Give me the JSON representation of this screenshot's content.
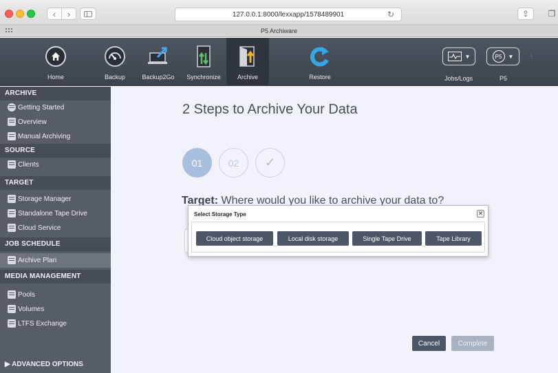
{
  "browser": {
    "url": "127.0.0.1:8000/lexxapp/1578489901",
    "tab_title": "P5   Archiware"
  },
  "toolbar": {
    "items": [
      {
        "label": "Home",
        "icon": "home-icon"
      },
      {
        "label": "Backup",
        "icon": "backup-gauge-icon"
      },
      {
        "label": "Backup2Go",
        "icon": "laptop-upload-icon"
      },
      {
        "label": "Synchronize",
        "icon": "synchronize-icon"
      },
      {
        "label": "Archive",
        "icon": "archive-door-icon",
        "active": true
      },
      {
        "label": "Restore",
        "icon": "restore-arrow-icon"
      }
    ],
    "jobs_label": "Jobs/Logs",
    "p5_label": "P5",
    "p5_badge": "P5"
  },
  "sidebar": {
    "archive_header": "ARCHIVE",
    "archive_items": [
      "Getting Started",
      "Overview",
      "Manual Archiving"
    ],
    "source_header": "SOURCE",
    "source_items": [
      "Clients"
    ],
    "target_header": "TARGET",
    "target_items": [
      "Storage Manager",
      "Standalone Tape Drive",
      "Cloud Service"
    ],
    "job_header": "JOB SCHEDULE",
    "job_items": [
      "Archive Plan"
    ],
    "media_header": "MEDIA MANAGEMENT",
    "media_items": [
      "Pools",
      "Volumes",
      "LTFS Exchange"
    ],
    "advanced": "▶ ADVANCED OPTIONS"
  },
  "main": {
    "title": "2 Steps to Archive Your Data",
    "steps": [
      "01",
      "02",
      "✓"
    ],
    "question_bold": "Target:",
    "question_text": " Where would you like to archive your data to?",
    "cancel": "Cancel",
    "complete": "Complete"
  },
  "modal": {
    "title": "Select Storage Type",
    "close": "✕",
    "options": [
      "Cloud object storage",
      "Local disk storage",
      "Single Tape Drive",
      "Tape Library"
    ]
  },
  "colors": {
    "toolbar_bg": "#434a54",
    "sidebar_bg": "#565d67",
    "main_bg": "#f2f3fa",
    "button_dark": "#4d5665",
    "step_active": "#a9bfe0"
  }
}
